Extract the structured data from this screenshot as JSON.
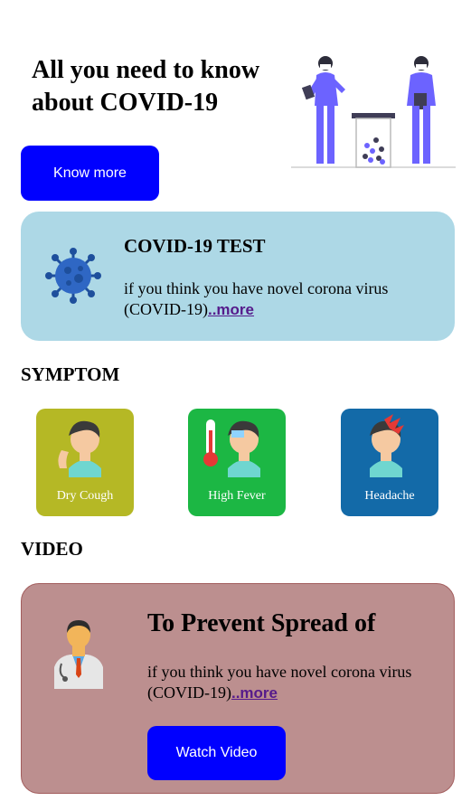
{
  "hero": {
    "title": "All you need to know about COVID-19",
    "button_label": "Know more"
  },
  "test_card": {
    "title": "COVID-19 TEST",
    "text": "if you think you have novel corona virus (COVID-19)",
    "more_link": "..more"
  },
  "symptom": {
    "heading": "SYMPTOM",
    "items": [
      {
        "label": "Dry Cough",
        "color": "#b5b825"
      },
      {
        "label": "High Fever",
        "color": "#1cb744"
      },
      {
        "label": "Headache",
        "color": "#136aa8"
      }
    ]
  },
  "video": {
    "heading": "VIDEO",
    "title": "To Prevent Spread of",
    "text": "if you think you have novel corona virus (COVID-19)",
    "more_link": "..more",
    "button_label": "Watch Video"
  },
  "colors": {
    "primary_button": "#0000ff",
    "test_card_bg": "#add8e6",
    "video_card_bg": "#bc8f8f"
  }
}
